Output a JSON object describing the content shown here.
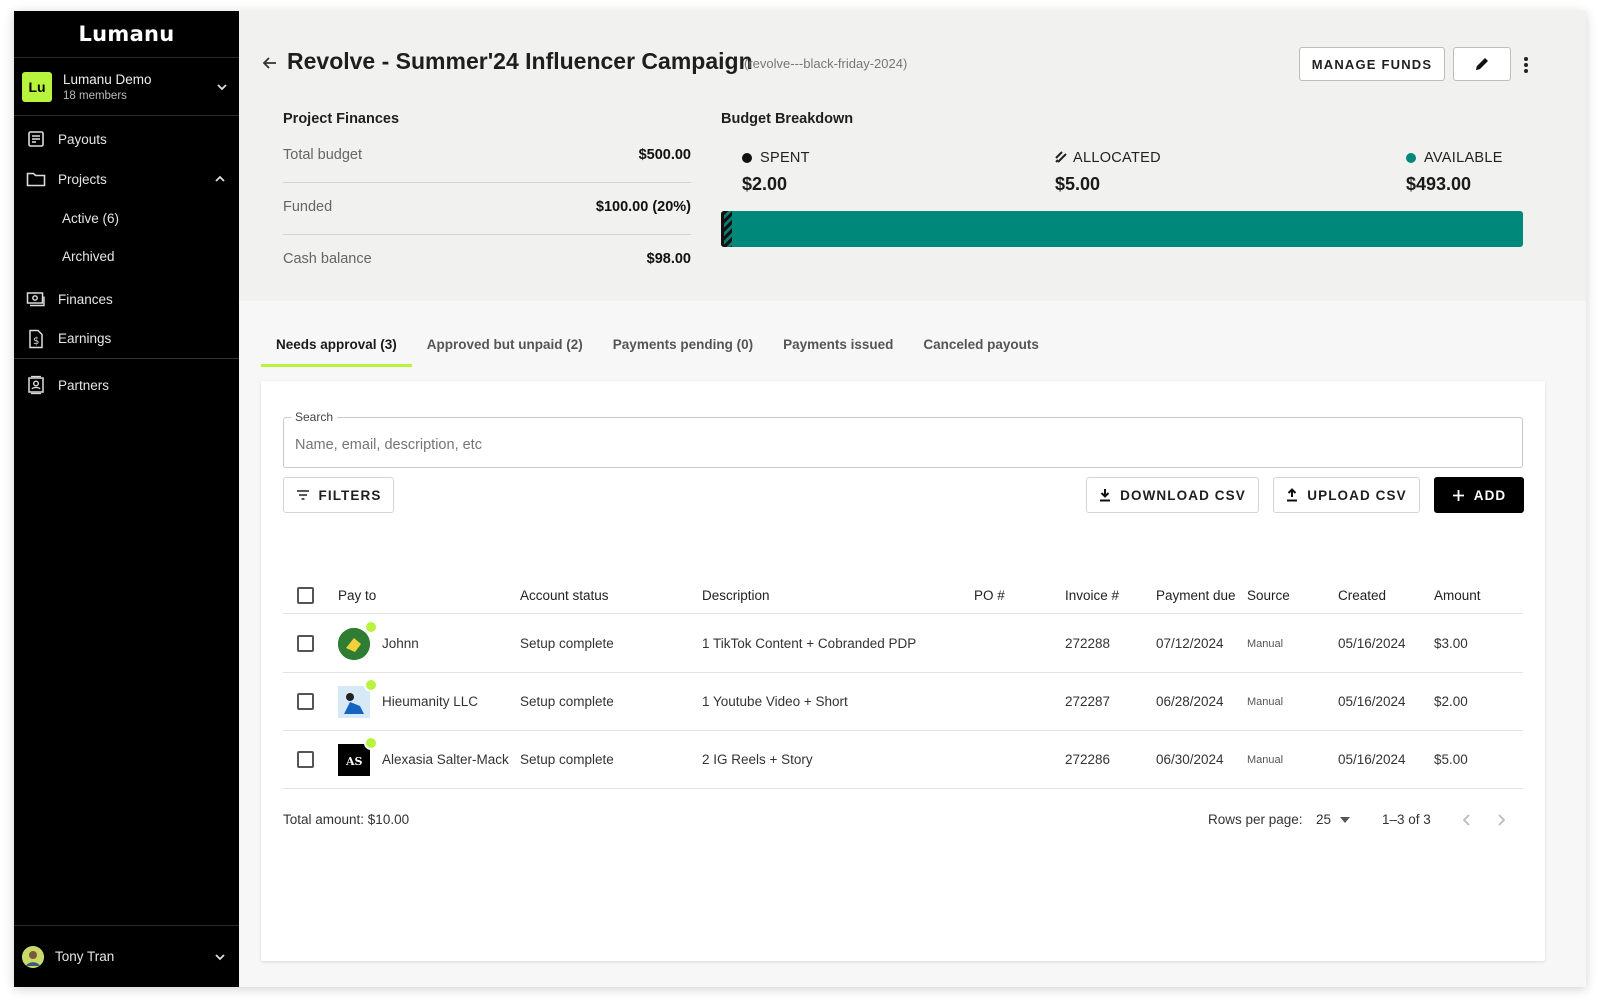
{
  "app": {
    "logo": "Lumanu"
  },
  "org": {
    "badge": "Lu",
    "name": "Lumanu Demo",
    "members": "18 members"
  },
  "nav": {
    "payouts": "Payouts",
    "projects": "Projects",
    "active": "Active (6)",
    "archived": "Archived",
    "finances": "Finances",
    "earnings": "Earnings",
    "partners": "Partners"
  },
  "user": {
    "name": "Tony Tran"
  },
  "header": {
    "title": "Revolve - Summer'24 Influencer Campaign",
    "slug": "(revolve---black-friday-2024)",
    "manage_funds": "MANAGE FUNDS"
  },
  "finances": {
    "heading": "Project Finances",
    "rows": [
      {
        "label": "Total budget",
        "value": "$500.00"
      },
      {
        "label": "Funded",
        "value": "$100.00 (20%)"
      },
      {
        "label": "Cash balance",
        "value": "$98.00"
      }
    ]
  },
  "budget": {
    "heading": "Budget Breakdown",
    "spent": {
      "label": "SPENT",
      "value": "$2.00",
      "amount": 2
    },
    "allocated": {
      "label": "ALLOCATED",
      "value": "$5.00",
      "amount": 5
    },
    "available": {
      "label": "AVAILABLE",
      "value": "$493.00",
      "amount": 493
    },
    "total": 500,
    "colors": {
      "spent": "#111111",
      "available": "#00897b"
    }
  },
  "tabs": [
    {
      "label": "Needs approval (3)",
      "active": true
    },
    {
      "label": "Approved but unpaid (2)",
      "active": false
    },
    {
      "label": "Payments pending (0)",
      "active": false
    },
    {
      "label": "Payments issued",
      "active": false
    },
    {
      "label": "Canceled payouts",
      "active": false
    }
  ],
  "search": {
    "label": "Search",
    "placeholder": "Name, email, description, etc"
  },
  "toolbar": {
    "filters": "FILTERS",
    "download": "DOWNLOAD CSV",
    "upload": "UPLOAD CSV",
    "add": "ADD"
  },
  "table": {
    "headers": [
      "Pay to",
      "Account status",
      "Description",
      "PO #",
      "Invoice #",
      "Payment due",
      "Source",
      "Created",
      "Amount"
    ],
    "rows": [
      {
        "pay_to": "Johnn",
        "status": "Setup complete",
        "description": "1 TikTok Content + Cobranded PDP",
        "po": "",
        "invoice": "272288",
        "due": "07/12/2024",
        "source": "Manual",
        "created": "05/16/2024",
        "amount": "$3.00"
      },
      {
        "pay_to": "Hieumanity LLC",
        "status": "Setup complete",
        "description": "1 Youtube Video + Short",
        "po": "",
        "invoice": "272287",
        "due": "06/28/2024",
        "source": "Manual",
        "created": "05/16/2024",
        "amount": "$2.00"
      },
      {
        "pay_to": "Alexasia Salter-Mack",
        "status": "Setup complete",
        "description": "2 IG Reels + Story",
        "po": "",
        "invoice": "272286",
        "due": "06/30/2024",
        "source": "Manual",
        "created": "05/16/2024",
        "amount": "$5.00"
      }
    ]
  },
  "footer": {
    "total": "Total amount: $10.00",
    "rows_per_page_label": "Rows per page:",
    "rows_per_page": "25",
    "range": "1–3 of 3"
  }
}
